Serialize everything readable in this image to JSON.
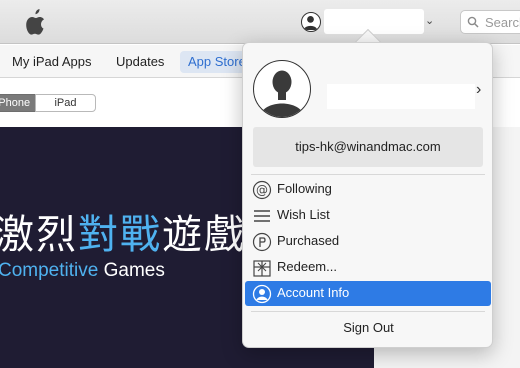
{
  "toolbar": {
    "search_placeholder": "Search"
  },
  "nav": {
    "items": [
      "My iPad Apps",
      "Updates",
      "App Store"
    ]
  },
  "device_toggle": {
    "options": [
      "iPhone",
      "iPad"
    ],
    "selected": "iPhone"
  },
  "banner": {
    "title_part1": "激烈",
    "title_highlight": "對戰",
    "title_part2": "遊戲",
    "subtitle_highlight": "Competitive",
    "subtitle_rest": " Games"
  },
  "account_menu": {
    "email": "tips-hk@winandmac.com",
    "items": [
      {
        "label": "Following",
        "icon": "at-icon"
      },
      {
        "label": "Wish List",
        "icon": "list-icon"
      },
      {
        "label": "Purchased",
        "icon": "purchased-icon"
      },
      {
        "label": "Redeem...",
        "icon": "gift-icon"
      },
      {
        "label": "Account Info",
        "icon": "person-icon",
        "selected": true
      }
    ],
    "sign_out": "Sign Out"
  },
  "colors": {
    "accent": "#2e7be5",
    "banner_bg": "#1f1c33",
    "banner_highlight": "#4fb2f0"
  }
}
